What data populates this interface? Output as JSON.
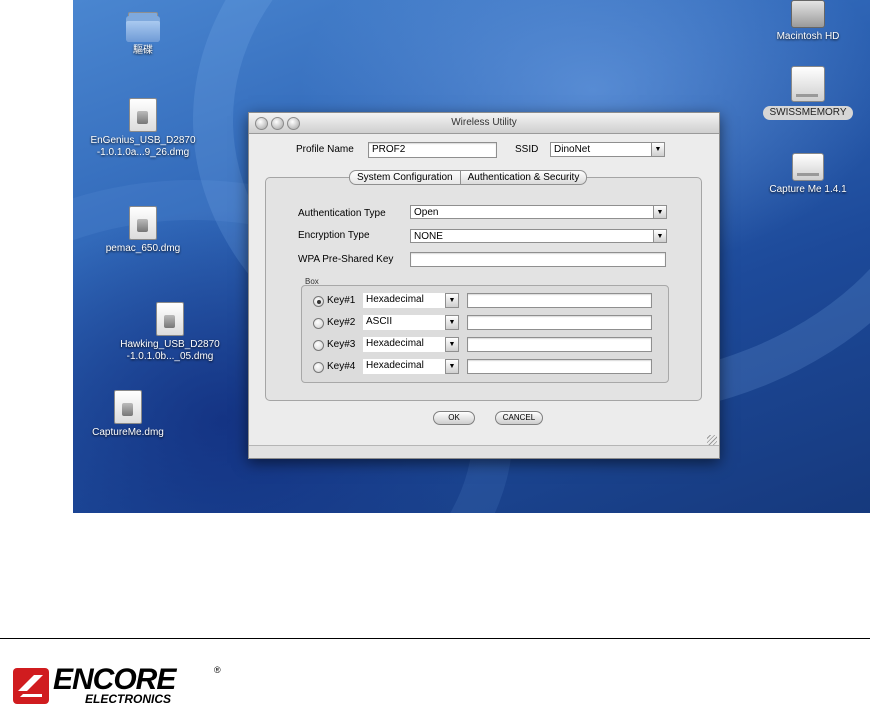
{
  "desktop": {
    "icons": [
      {
        "label": "驅碟"
      },
      {
        "label": "EnGenius_USB_D2870\n-1.0.1.0a...9_26.dmg"
      },
      {
        "label": "pemac_650.dmg"
      },
      {
        "label": "Hawking_USB_D2870\n-1.0.1.0b..._05.dmg"
      },
      {
        "label": "CaptureMe.dmg"
      },
      {
        "label": "Macintosh HD"
      },
      {
        "label": "SWISSMEMORY"
      },
      {
        "label": "Capture Me 1.4.1"
      }
    ]
  },
  "window": {
    "title": "Wireless Utility",
    "profile_name_label": "Profile Name",
    "profile_name_value": "PROF2",
    "ssid_label": "SSID",
    "ssid_value": "DinoNet",
    "tabs": [
      {
        "label": "System Configuration"
      },
      {
        "label": "Authentication & Security"
      }
    ],
    "auth_type_label": "Authentication Type",
    "auth_type_value": "Open",
    "encryption_label": "Encryption Type",
    "encryption_value": "NONE",
    "wpa_label": "WPA Pre-Shared Key",
    "wpa_value": "",
    "box_label": "Box",
    "keys": [
      {
        "label": "Key#1",
        "format": "Hexadecimal",
        "value": "",
        "selected": true
      },
      {
        "label": "Key#2",
        "format": "ASCII",
        "value": "",
        "selected": false
      },
      {
        "label": "Key#3",
        "format": "Hexadecimal",
        "value": "",
        "selected": false
      },
      {
        "label": "Key#4",
        "format": "Hexadecimal",
        "value": "",
        "selected": false
      }
    ],
    "ok_label": "OK",
    "cancel_label": "CANCEL"
  },
  "footer": {
    "brand": "ENCORE",
    "brand_sub": "ELECTRONICS",
    "registered": "®"
  }
}
